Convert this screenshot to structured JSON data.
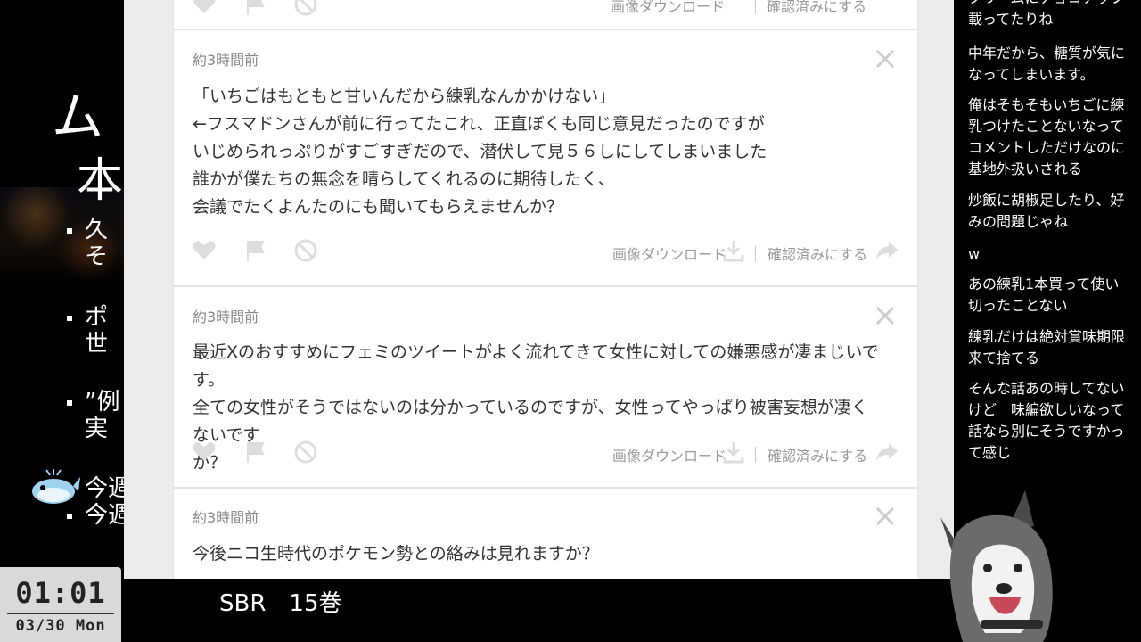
{
  "slide": {
    "title_line1": "ム",
    "title_line2": "本",
    "bullets": [
      {
        "line1": "久",
        "line2": "そ"
      },
      {
        "line1": "ポ",
        "line2": "世"
      },
      {
        "line1": "”例",
        "line2": "実"
      },
      {
        "line1": "今週",
        "line2": "今週"
      }
    ]
  },
  "clock": {
    "time": "01:01",
    "date": "03/30 Mon"
  },
  "caption": "SBR　15巻",
  "panel": {
    "top_actions": {
      "download_label": "画像ダウンロード",
      "confirm_label": "確認済みにする"
    },
    "cards": [
      {
        "time": "約3時間前",
        "lines": [
          "「いちごはもともと甘いんだから練乳なんかかけない」",
          "←フスマドンさんが前に行ってたこれ、正直ぼくも同じ意見だったのですが",
          "いじめられっぷりがすごすぎだので、潜伏して見５６しにしてしまいました",
          "誰かが僕たちの無念を晴らしてくれるのに期待したく、",
          "会議でたくよんたのにも聞いてもらえませんか？"
        ],
        "download_label": "画像ダウンロード",
        "confirm_label": "確認済みにする"
      },
      {
        "time": "約3時間前",
        "lines": [
          "最近Xのおすすめにフェミのツイートがよく流れてきて女性に対しての嫌悪感が凄まじいです。",
          "全ての女性がそうではないのは分かっているのですが、女性ってやっぱり被害妄想が凄くないです",
          "か？"
        ],
        "download_label": "画像ダウンロード",
        "confirm_label": "確認済みにする"
      },
      {
        "time": "約3時間前",
        "lines": [
          "今後ニコ生時代のポケモン勢との絡みは見れますか？"
        ]
      }
    ]
  },
  "chat": {
    "messages": [
      "クリームにチョコチップ載ってたりね",
      "中年だから、糖質が気になってしまいます。",
      "俺はそもそもいちごに練乳つけたことないなってコメントしただけなのに基地外扱いされる",
      "炒飯に胡椒足したり、好みの問題じゃね",
      "w",
      "あの練乳1本買って使い切ったことない",
      "練乳だけは絶対賞味期限来て捨てる",
      "そんな話あの時してないけど　味編欲しいなって話なら別にそうですかって感じ"
    ]
  }
}
